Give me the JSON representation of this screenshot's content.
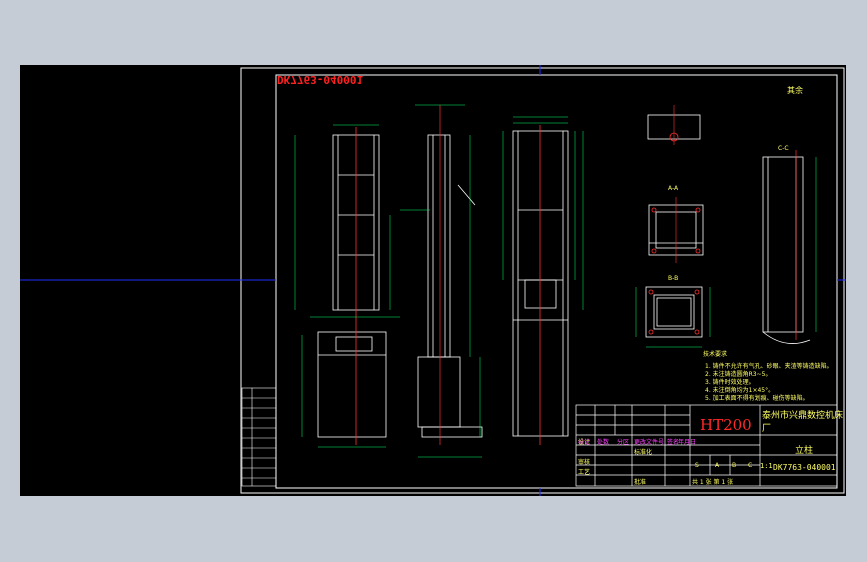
{
  "drawing": {
    "drawing_number_top": "DK7763-040001",
    "drawing_number_block": "DK7763-040001",
    "material": "HT200",
    "factory": "泰州市兴鼎数控机床厂",
    "part_name": "立柱",
    "scale": "1:1",
    "check_mark": "其余",
    "sheet_info": "共 1 张 第 1 张",
    "tech_req_title": "技术要求",
    "tech_req": [
      "1. 铸件不允许有气孔、砂眼、夹渣等铸造缺陷。",
      "2. 未注铸造圆角R3~5。",
      "3. 铸件时效处理。",
      "4. 未注倒角均为1×45°。",
      "5. 加工表面不得有划痕、碰伤等缺陷。"
    ],
    "section_labels": [
      "A-A",
      "B-B",
      "C-C"
    ],
    "title_block_rows": [
      "标记",
      "处数",
      "分区",
      "更改文件号",
      "签名",
      "年月日"
    ],
    "title_block_left": [
      "设计",
      "校对",
      "审核",
      "工艺"
    ],
    "stage_labels": [
      "S",
      "A",
      "B",
      "C"
    ],
    "std": "标准化",
    "approve": "批准",
    "colors": {
      "frame": "#ffffff",
      "dims": "#00ff66",
      "lines": "#ffffff",
      "center": "#ff3030",
      "blue": "#2030ff"
    }
  }
}
